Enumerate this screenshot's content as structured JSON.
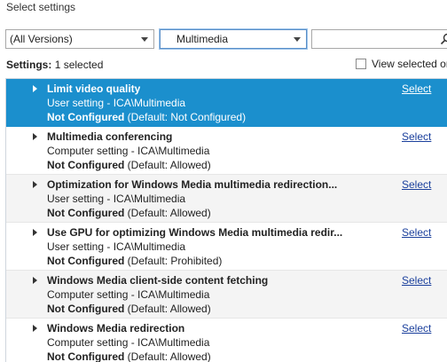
{
  "header": {
    "title": "Select settings"
  },
  "filters": {
    "versions": "(All Versions)",
    "category": "Multimedia",
    "search_value": "",
    "search_placeholder": ""
  },
  "summary": {
    "label": "Settings:",
    "count_text": "1 selected",
    "view_selected_label": "View selected on"
  },
  "settings": [
    {
      "title": "Limit video quality",
      "type": "User setting - ICA\\Multimedia",
      "state": "Not Configured",
      "default": "(Default: Not Configured)",
      "link": "Select"
    },
    {
      "title": "Multimedia conferencing",
      "type": "Computer setting - ICA\\Multimedia",
      "state": "Not Configured",
      "default": "(Default: Allowed)",
      "link": "Select"
    },
    {
      "title": "Optimization for Windows Media multimedia redirection...",
      "type": "User setting - ICA\\Multimedia",
      "state": "Not Configured",
      "default": "(Default: Allowed)",
      "link": "Select"
    },
    {
      "title": "Use GPU for optimizing Windows Media multimedia redir...",
      "type": "User setting - ICA\\Multimedia",
      "state": "Not Configured",
      "default": "(Default: Prohibited)",
      "link": "Select"
    },
    {
      "title": "Windows Media client-side content fetching",
      "type": "Computer setting - ICA\\Multimedia",
      "state": "Not Configured",
      "default": "(Default: Allowed)",
      "link": "Select"
    },
    {
      "title": "Windows Media redirection",
      "type": "Computer setting - ICA\\Multimedia",
      "state": "Not Configured",
      "default": "(Default: Allowed)",
      "link": "Select"
    }
  ],
  "colors": {
    "selection": "#1b8fcd",
    "link": "#1a3f9c",
    "alt_row": "#f4f4f4"
  },
  "icons": {
    "search": "search-icon",
    "expander": "expand-arrow-icon",
    "dropdown": "chevron-down-icon"
  }
}
